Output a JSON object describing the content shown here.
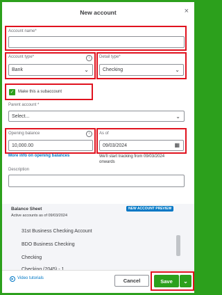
{
  "modal": {
    "title": "New account",
    "close_glyph": "×"
  },
  "account_name": {
    "label": "Account name*",
    "value": ""
  },
  "account_type": {
    "label": "Account type*",
    "value": "Bank"
  },
  "detail_type": {
    "label": "Detail type*",
    "value": "Checking"
  },
  "subaccount": {
    "label": "Make this a subaccount",
    "checked": true
  },
  "parent_account": {
    "label": "Parent account *",
    "placeholder": "Select..."
  },
  "opening_balance": {
    "label": "Opening balance",
    "value": "10,000.00",
    "more_info_link": "More info on opening balances"
  },
  "as_of": {
    "label": "As of",
    "value": "09/03/2024",
    "tracking_note_line1": "We'll start tracking from 09/03/2024",
    "tracking_note_line2": "onwards"
  },
  "description": {
    "label": "Description",
    "value": ""
  },
  "balance_sheet": {
    "title": "Balance Sheet",
    "subtitle": "Active accounts as of 09/03/2024",
    "badge": "NEW ACCOUNT PREVIEW",
    "accounts": [
      "31st Business Checking Account",
      "BDO Business Checking",
      "Checking",
      "Checking (2045) - 1"
    ]
  },
  "footer": {
    "video_link": "Video tutorials",
    "cancel_label": "Cancel",
    "save_label": "Save"
  },
  "colors": {
    "brand_green": "#2ca01c",
    "highlight_red": "#e0121e",
    "link_blue": "#0077c5"
  }
}
